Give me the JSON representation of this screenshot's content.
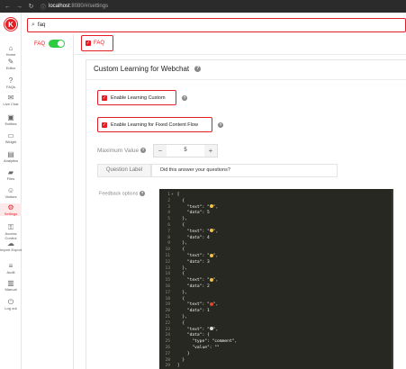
{
  "browser": {
    "url_host": "localhost",
    "url_path": ":8080/#/settings"
  },
  "app": {
    "logo_letter": "K",
    "brand_color": "#e51c23"
  },
  "sidebar": {
    "items": [
      {
        "label": "Home",
        "icon": "home-icon"
      },
      {
        "label": "Editor",
        "icon": "pencil-icon"
      },
      {
        "label": "FAQs",
        "icon": "question-icon"
      },
      {
        "label": "Live Chat",
        "icon": "chat-icon"
      },
      {
        "label": "Entities",
        "icon": "cube-icon"
      },
      {
        "label": "Widget",
        "icon": "monitor-icon"
      },
      {
        "label": "Analytics",
        "icon": "chart-icon"
      },
      {
        "label": "Files",
        "icon": "folder-icon"
      },
      {
        "label": "Visitors",
        "icon": "user-icon"
      },
      {
        "label": "Settings",
        "icon": "gear-icon",
        "active": true
      },
      {
        "label": "Access Control",
        "icon": "key-icon"
      },
      {
        "label": "Import Export",
        "icon": "cloud-icon"
      },
      {
        "label": "Audit",
        "icon": "list-icon"
      },
      {
        "label": "Manual",
        "icon": "book-icon"
      },
      {
        "label": "Log out",
        "icon": "logout-icon"
      }
    ]
  },
  "search": {
    "value": "faq"
  },
  "left_panel": {
    "faq_label": "FAQ",
    "faq_toggle_on": true
  },
  "tab": {
    "faq_label": "FAQ"
  },
  "panel": {
    "title": "Custom Learning for Webchat",
    "enable_custom_label": "Enable Learning Custom",
    "enable_fixed_label": "Enable Learning for Fixed Content Flow",
    "max_value_label": "Maximum Value",
    "max_value": "5",
    "minus": "−",
    "plus": "+",
    "question_label": "Question Label",
    "question_value": "Did this answer your questions?",
    "feedback_label": "Feedback options"
  },
  "code_lines": [
    {
      "n": "1",
      "fold": "▾",
      "t": "["
    },
    {
      "n": "2",
      "fold": "",
      "t": "  {"
    },
    {
      "n": "3",
      "fold": "",
      "t": "    \"text\": \"",
      "emoji": "#f5c242",
      "t2": "\","
    },
    {
      "n": "4",
      "fold": "",
      "t": "    \"data\": 5"
    },
    {
      "n": "5",
      "fold": "",
      "t": "  },"
    },
    {
      "n": "6",
      "fold": "",
      "t": "  {"
    },
    {
      "n": "7",
      "fold": "",
      "t": "    \"text\": \"",
      "emoji": "#f5c242",
      "t2": "\","
    },
    {
      "n": "8",
      "fold": "",
      "t": "    \"data\": 4"
    },
    {
      "n": "9",
      "fold": "",
      "t": "  },"
    },
    {
      "n": "10",
      "fold": "",
      "t": "  {"
    },
    {
      "n": "11",
      "fold": "",
      "t": "    \"text\": \"",
      "emoji": "#f5c242",
      "t2": "\","
    },
    {
      "n": "12",
      "fold": "",
      "t": "    \"data\": 3"
    },
    {
      "n": "13",
      "fold": "",
      "t": "  },"
    },
    {
      "n": "14",
      "fold": "",
      "t": "  {"
    },
    {
      "n": "15",
      "fold": "",
      "t": "    \"text\": \"",
      "emoji": "#f5c242",
      "t2": "\","
    },
    {
      "n": "16",
      "fold": "",
      "t": "    \"data\": 2"
    },
    {
      "n": "17",
      "fold": "",
      "t": "  },"
    },
    {
      "n": "18",
      "fold": "",
      "t": "  {"
    },
    {
      "n": "19",
      "fold": "",
      "t": "    \"text\": \"",
      "emoji": "#e0452b",
      "t2": "\","
    },
    {
      "n": "20",
      "fold": "",
      "t": "    \"data\": 1"
    },
    {
      "n": "21",
      "fold": "",
      "t": "  },"
    },
    {
      "n": "22",
      "fold": "",
      "t": "  {"
    },
    {
      "n": "23",
      "fold": "",
      "t": "    \"text\": \"",
      "emoji": "#dddddd",
      "t2": "\","
    },
    {
      "n": "24",
      "fold": "",
      "t": "    \"data\": {"
    },
    {
      "n": "25",
      "fold": "",
      "t": "      \"type\": \"comment\","
    },
    {
      "n": "26",
      "fold": "",
      "t": "      \"value\": \"\""
    },
    {
      "n": "27",
      "fold": "",
      "t": "    }"
    },
    {
      "n": "28",
      "fold": "",
      "t": "  }"
    },
    {
      "n": "29",
      "fold": "",
      "t": "]"
    }
  ]
}
